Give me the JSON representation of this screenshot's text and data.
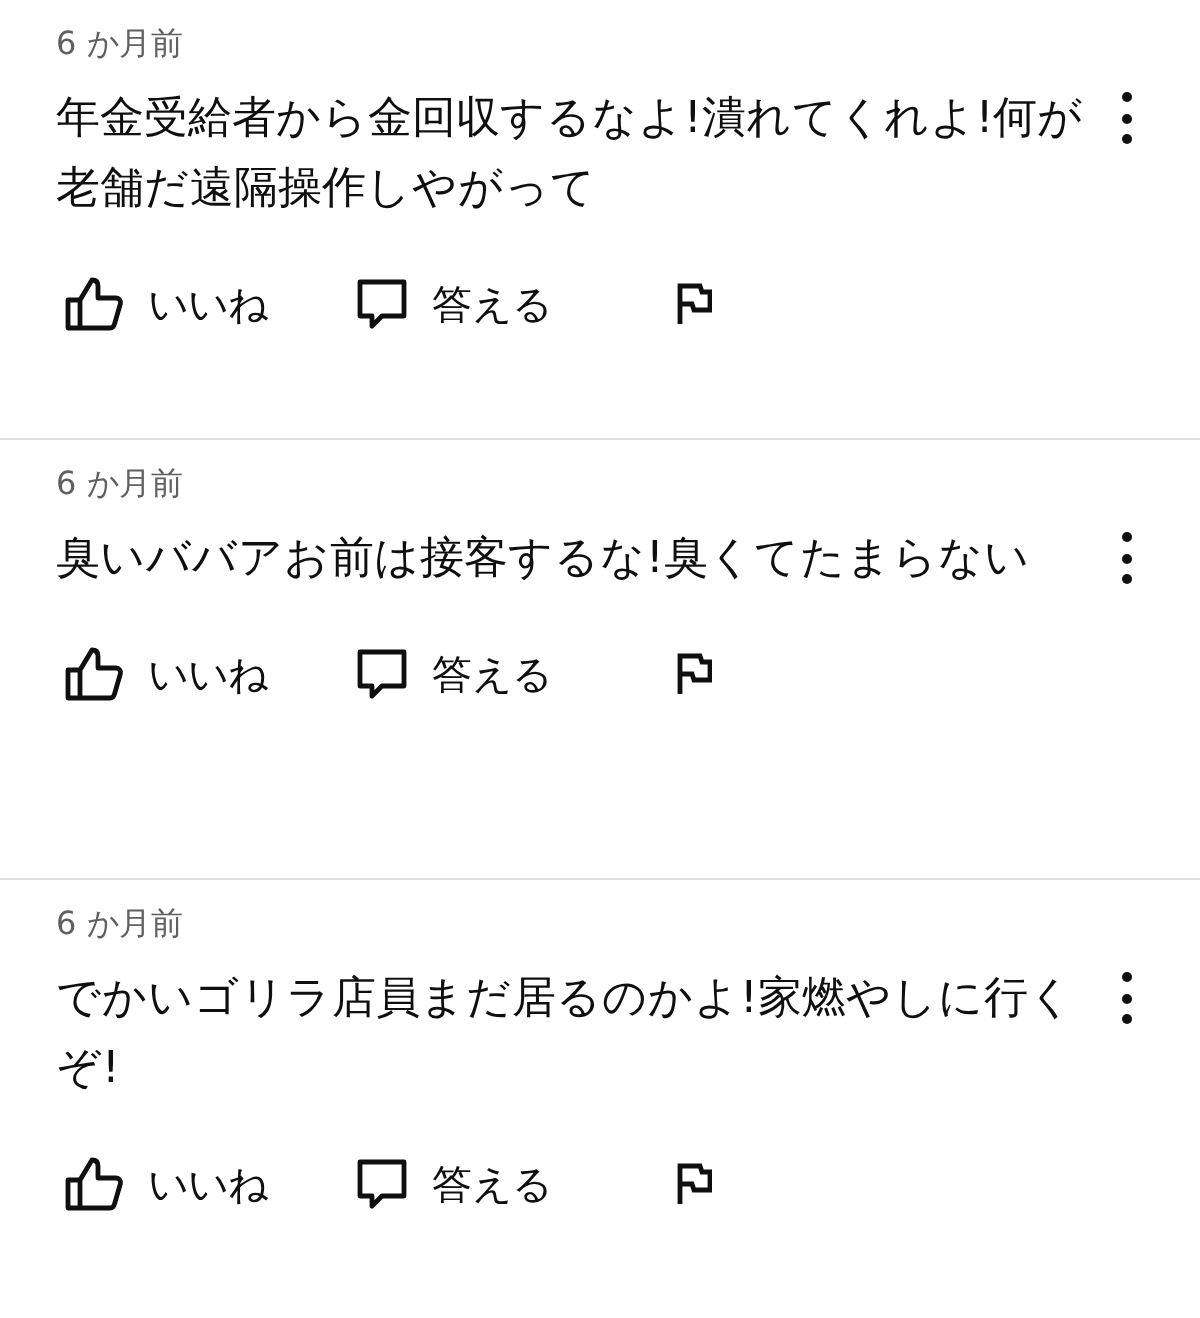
{
  "comments": [
    {
      "time": "6 か月前",
      "text": "年金受給者から金回収するなよ!潰れてくれよ!何が老舗だ遠隔操作しやがって",
      "like_label": "いいね",
      "reply_label": "答える"
    },
    {
      "time": "6 か月前",
      "text": "臭いババアお前は接客するな!臭くてたまらない",
      "like_label": "いいね",
      "reply_label": "答える"
    },
    {
      "time": "6 か月前",
      "text": "でかいゴリラ店員まだ居るのかよ!家燃やしに行くぞ!",
      "like_label": "いいね",
      "reply_label": "答える"
    }
  ]
}
